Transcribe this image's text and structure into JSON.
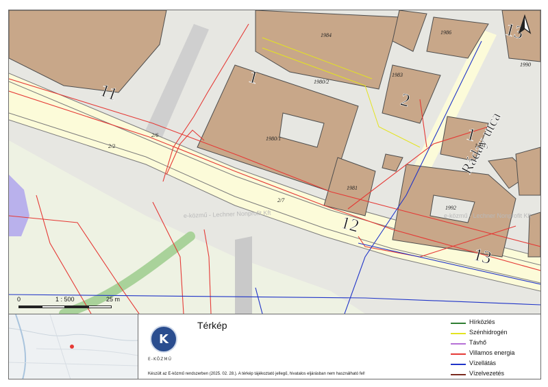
{
  "map": {
    "parcel_numbers": [
      "1984",
      "1986",
      "1990",
      "1980/2",
      "1983",
      "1980/1",
      "1991",
      "1981",
      "1992",
      "2/6",
      "2/2",
      "2/7"
    ],
    "house_numbers": [
      "11",
      "1",
      "2",
      "1",
      "12",
      "13",
      "13"
    ],
    "street_name": "Ráday utca",
    "watermark": "e-közmű - Lechner Nonprofit Kft",
    "colors": {
      "building": "#c8a789",
      "road": "#fcfbd9",
      "plot": "#e7e7e2",
      "water_area": "#b9b1ec",
      "greenway": "#a9d29a"
    }
  },
  "scalebar": {
    "zero": "0",
    "ratio": "1 : 500",
    "distance": "25 m"
  },
  "panel": {
    "title": "Térkép",
    "logo_letter": "K",
    "logo_name": "E-KÖZMŰ",
    "notice": "Készült az E-közmű rendszerben (2025. 02. 28.). A térkép tájékoztató jellegű, hivatalos eljárásban nem használható fel!",
    "overview_marker_color": "#e53935"
  },
  "legend": [
    {
      "label": "Hírközlés",
      "color": "#2e7d32"
    },
    {
      "label": "Szénhidrogén",
      "color": "#e3e320"
    },
    {
      "label": "Távhő",
      "color": "#b56fd6"
    },
    {
      "label": "Villamos energia",
      "color": "#e53935"
    },
    {
      "label": "Vízellátás",
      "color": "#1e33c8"
    },
    {
      "label": "Vízelvezetés",
      "color": "#7b2a1e"
    }
  ],
  "compass": {
    "icon": "north-arrow-icon"
  }
}
